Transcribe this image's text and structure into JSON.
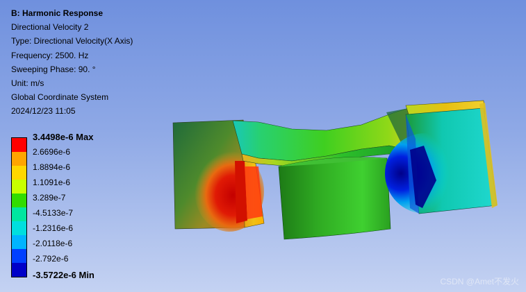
{
  "result": {
    "title": "B: Harmonic Response",
    "name": "Directional Velocity 2",
    "type": "Type: Directional Velocity(X Axis)",
    "frequency": "Frequency: 2500. Hz",
    "phase": "Sweeping Phase: 90. °",
    "unit": "Unit: m/s",
    "coordinate_system": "Global Coordinate System",
    "timestamp": "2024/12/23 11:05"
  },
  "legend": {
    "labels": [
      "3.4498e-6 Max",
      "2.6696e-6",
      "1.8894e-6",
      "1.1091e-6",
      "3.289e-7",
      "-4.5133e-7",
      "-1.2316e-6",
      "-2.0118e-6",
      "-2.792e-6",
      "-3.5722e-6 Min"
    ],
    "colors": [
      "#ff0000",
      "#ffa500",
      "#ffd700",
      "#c8ff00",
      "#32dc00",
      "#00e6a0",
      "#00dede",
      "#00b4ff",
      "#0040ff",
      "#0000c8"
    ]
  },
  "watermark": "CSDN @Amet不发火"
}
